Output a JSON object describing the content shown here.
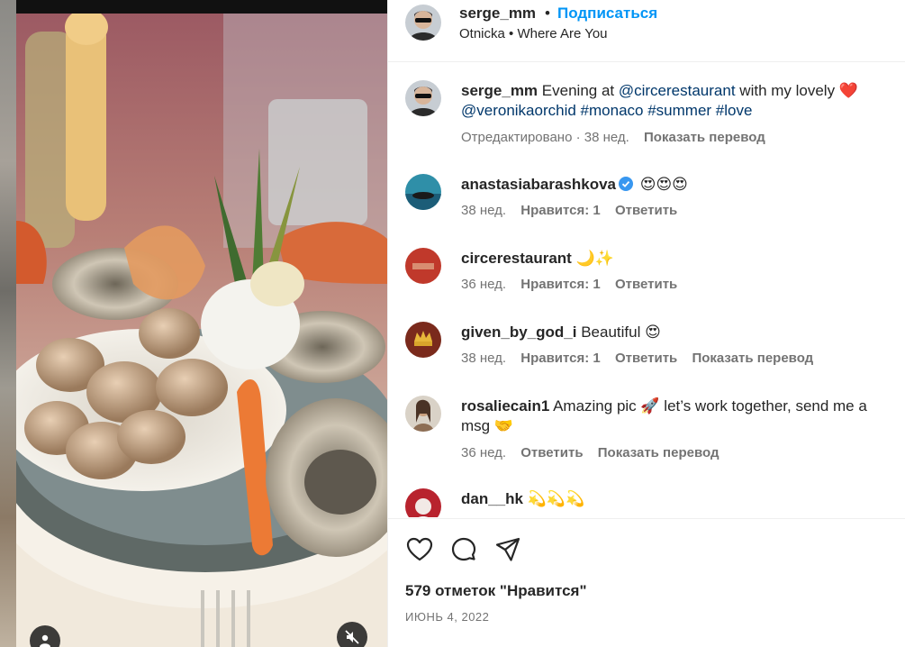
{
  "post": {
    "author": "serge_mm",
    "separator": "•",
    "follow_label": "Подписаться",
    "audio": "Otnicka • Where Are You"
  },
  "caption": {
    "username": "serge_mm",
    "text_1": "Evening at ",
    "mention_1": "@circerestaurant",
    "text_2": " with my lovely ❤️",
    "mention_2": "@veronikaorchid",
    "tags": " #monaco #summer #love",
    "edited": "Отредактировано · 38 нед.",
    "translate": "Показать перевод"
  },
  "comments": [
    {
      "username": "anastasiabarashkova",
      "text": "😍😍😍",
      "verified": true,
      "age": "38 нед.",
      "likes": "Нравится: 1",
      "reply": "Ответить",
      "translate": ""
    },
    {
      "username": "circerestaurant",
      "text": "🌙✨",
      "verified": false,
      "age": "36 нед.",
      "likes": "Нравится: 1",
      "reply": "Ответить",
      "translate": ""
    },
    {
      "username": "given_by_god_i",
      "text": "Beautiful 😍",
      "verified": false,
      "age": "38 нед.",
      "likes": "Нравится: 1",
      "reply": "Ответить",
      "translate": "Показать перевод"
    },
    {
      "username": "rosaliecain1",
      "text": "Amazing pic 🚀 let’s work together, send me a msg 🤝",
      "verified": false,
      "age": "36 нед.",
      "likes": "",
      "reply": "Ответить",
      "translate": "Показать перевод"
    },
    {
      "username": "dan__hk",
      "text": "💫💫💫",
      "verified": false,
      "age": "",
      "likes": "",
      "reply": "",
      "translate": ""
    }
  ],
  "footer": {
    "likes": "579 отметок \"Нравится\"",
    "date": "ИЮНЬ 4, 2022"
  },
  "icons": {
    "like": "heart-icon",
    "comment": "comment-icon",
    "share": "share-icon",
    "user": "user-icon",
    "mute": "speaker-muted-icon"
  },
  "colors": {
    "accent": "#0095f6",
    "link": "#00376b",
    "muted": "#737373",
    "verified": "#3897f0"
  }
}
